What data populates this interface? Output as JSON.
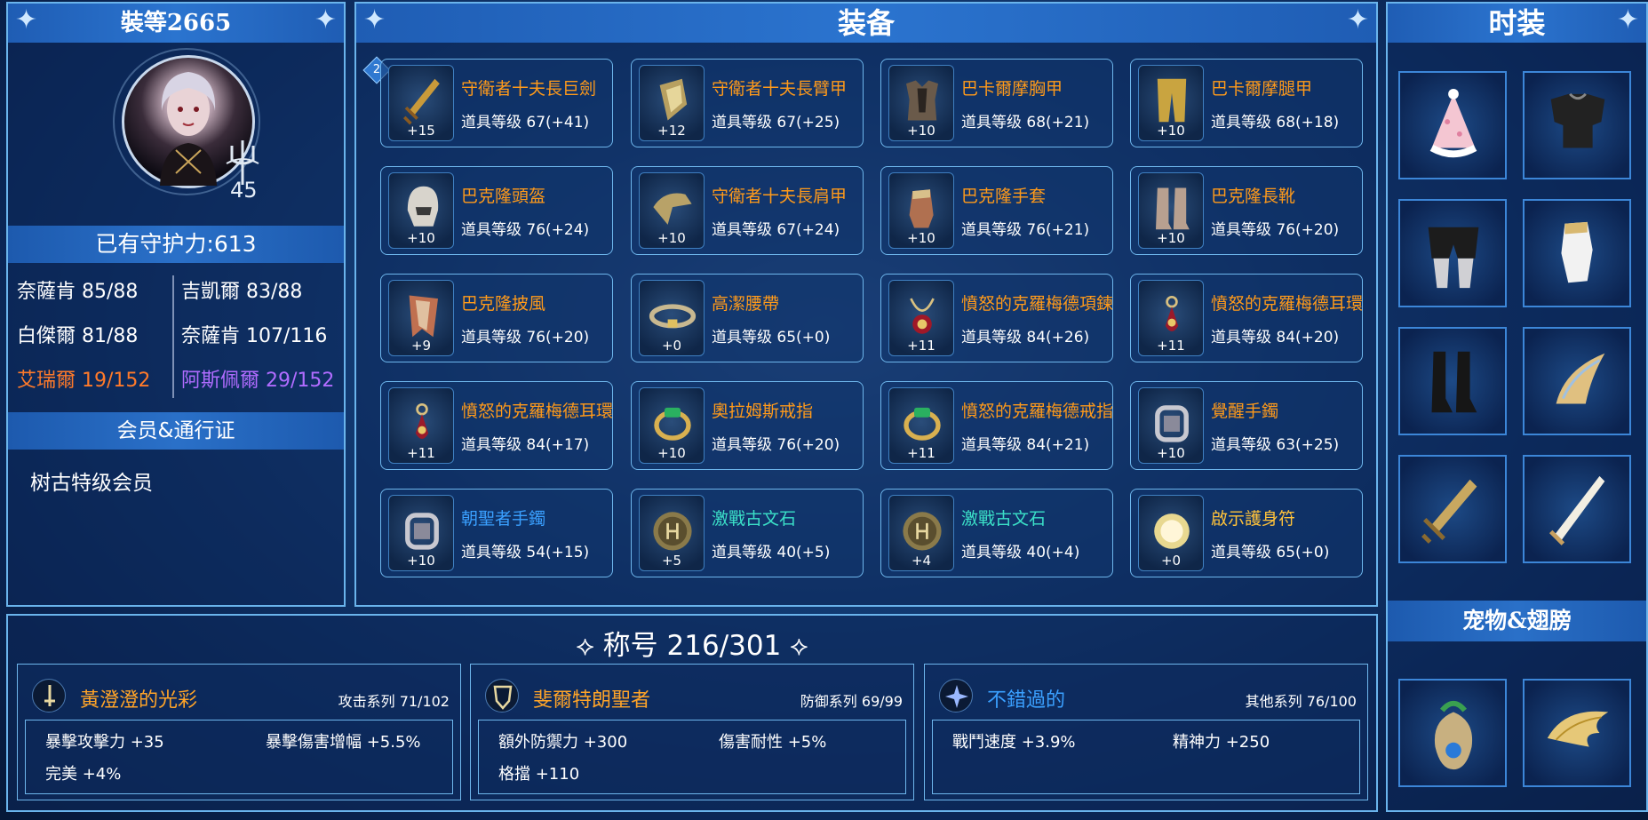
{
  "left": {
    "title": "裝等2665",
    "level": "45",
    "guard": "已有守护力:613",
    "stats": [
      {
        "text": "奈薩肯 85/88",
        "color": "#ffffff"
      },
      {
        "text": "吉凱爾 83/88",
        "color": "#ffffff"
      },
      {
        "text": "白傑爾 81/88",
        "color": "#ffffff"
      },
      {
        "text": "奈薩肯 107/116",
        "color": "#ffffff"
      },
      {
        "text": "艾瑞爾 19/152",
        "color": "#ff7a2a"
      },
      {
        "text": "阿斯佩爾 29/152",
        "color": "#b06cff"
      }
    ],
    "member_title": "会员&通行证",
    "member_text": "树古特级会员"
  },
  "equip": {
    "title": "装备",
    "badge": "2",
    "items": [
      {
        "name": "守衛者十夫長巨劍",
        "level": "道具等级 67(+41)",
        "plus": "+15",
        "icon": "greatsword-icon",
        "color": "orange"
      },
      {
        "name": "守衛者十夫長臂甲",
        "level": "道具等级 67(+25)",
        "plus": "+12",
        "icon": "bracer-icon",
        "color": "orange"
      },
      {
        "name": "巴卡爾摩胸甲",
        "level": "道具等级 68(+21)",
        "plus": "+10",
        "icon": "chestplate-icon",
        "color": "orange"
      },
      {
        "name": "巴卡爾摩腿甲",
        "level": "道具等级 68(+18)",
        "plus": "+10",
        "icon": "leggings-icon",
        "color": "orange"
      },
      {
        "name": "巴克隆頭盔",
        "level": "道具等级 76(+24)",
        "plus": "+10",
        "icon": "helmet-icon",
        "color": "orange"
      },
      {
        "name": "守衛者十夫長肩甲",
        "level": "道具等级 67(+24)",
        "plus": "+10",
        "icon": "shoulder-icon",
        "color": "orange"
      },
      {
        "name": "巴克隆手套",
        "level": "道具等级 76(+21)",
        "plus": "+10",
        "icon": "gloves-icon",
        "color": "orange"
      },
      {
        "name": "巴克隆長靴",
        "level": "道具等级 76(+20)",
        "plus": "+10",
        "icon": "boots-icon",
        "color": "orange"
      },
      {
        "name": "巴克隆披風",
        "level": "道具等级 76(+20)",
        "plus": "+9",
        "icon": "cape-icon",
        "color": "orange"
      },
      {
        "name": "高潔腰帶",
        "level": "道具等级 65(+0)",
        "plus": "+0",
        "icon": "belt-icon",
        "color": "orange"
      },
      {
        "name": "憤怒的克羅梅德項鍊",
        "level": "道具等级 84(+26)",
        "plus": "+11",
        "icon": "necklace-icon",
        "color": "orange"
      },
      {
        "name": "憤怒的克羅梅德耳環",
        "level": "道具等级 84(+20)",
        "plus": "+11",
        "icon": "earring-icon",
        "color": "orange"
      },
      {
        "name": "憤怒的克羅梅德耳環",
        "level": "道具等级 84(+17)",
        "plus": "+11",
        "icon": "earring-icon",
        "color": "orange"
      },
      {
        "name": "奧拉姆斯戒指",
        "level": "道具等级 76(+20)",
        "plus": "+10",
        "icon": "ring-icon",
        "color": "orange"
      },
      {
        "name": "憤怒的克羅梅德戒指",
        "level": "道具等级 84(+21)",
        "plus": "+11",
        "icon": "ring-icon",
        "color": "orange"
      },
      {
        "name": "覺醒手鐲",
        "level": "道具等级 63(+25)",
        "plus": "+10",
        "icon": "bracelet-icon",
        "color": "orange"
      },
      {
        "name": "朝聖者手鐲",
        "level": "道具等级 54(+15)",
        "plus": "+10",
        "icon": "bracelet-icon",
        "color": "blue"
      },
      {
        "name": "激戰古文石",
        "level": "道具等级 40(+5)",
        "plus": "+5",
        "icon": "runestone-icon",
        "color": "cyan"
      },
      {
        "name": "激戰古文石",
        "level": "道具等级 40(+4)",
        "plus": "+4",
        "icon": "runestone-icon",
        "color": "cyan"
      },
      {
        "name": "啟示護身符",
        "level": "道具等级 65(+0)",
        "plus": "+0",
        "icon": "amulet-icon",
        "color": "gold"
      }
    ]
  },
  "fashion": {
    "title": "时装",
    "items": [
      {
        "icon": "party-hat-icon"
      },
      {
        "icon": "top-icon"
      },
      {
        "icon": "shorts-icon"
      },
      {
        "icon": "glove-icon"
      },
      {
        "icon": "boots-icon"
      },
      {
        "icon": "wing-ornament-icon"
      },
      {
        "icon": "weapon-skin-icon"
      },
      {
        "icon": "sword-skin-icon"
      }
    ],
    "pets_title": "宠物&翅膀",
    "pets": [
      {
        "icon": "pet-icon"
      },
      {
        "icon": "wings-icon"
      }
    ]
  },
  "titles": {
    "header": "称号 216/301",
    "cards": [
      {
        "name": "黃澄澄的光彩",
        "category": "攻击系列 71/102",
        "color": "orange",
        "icon": "sword-emblem-icon",
        "stats": [
          "暴擊攻擊力 +35",
          "暴擊傷害增幅 +5.5%",
          "完美 +4%"
        ]
      },
      {
        "name": "斐爾特朗聖者",
        "category": "防御系列 69/99",
        "color": "orange",
        "icon": "shield-emblem-icon",
        "stats": [
          "額外防禦力 +300",
          "傷害耐性 +5%",
          "格擋 +110"
        ]
      },
      {
        "name": "不錯過的",
        "category": "其他系列 76/100",
        "color": "blue",
        "icon": "star-emblem-icon",
        "stats": [
          "戰鬥速度 +3.9%",
          "精神力 +250"
        ]
      }
    ]
  }
}
